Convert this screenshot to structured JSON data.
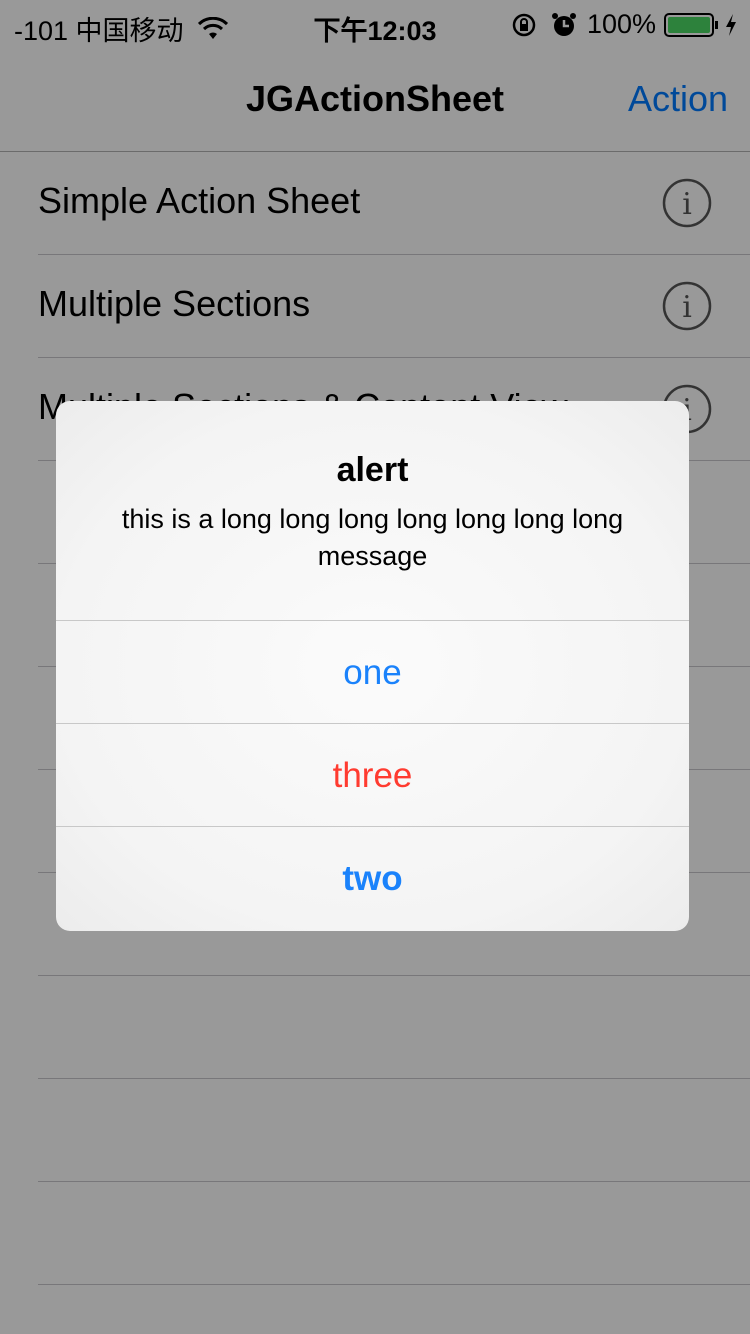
{
  "status_bar": {
    "carrier": "-101 中国移动",
    "time": "下午12:03",
    "battery": "100%",
    "icons": [
      "wifi-icon",
      "rotation-lock-icon",
      "alarm-icon",
      "battery-icon",
      "charging-icon"
    ]
  },
  "nav": {
    "title": "JGActionSheet",
    "action_label": "Action"
  },
  "table": {
    "rows": [
      {
        "label": "Simple Action Sheet",
        "icon": "info-icon"
      },
      {
        "label": "Multiple Sections",
        "icon": "info-icon"
      },
      {
        "label": "Multiple Sections & Content View",
        "icon": "info-icon"
      }
    ]
  },
  "alert": {
    "title": "alert",
    "message": "this is a long long long long long long long message",
    "buttons": [
      {
        "label": "one",
        "color": "#1a82fb"
      },
      {
        "label": "three",
        "color": "#ff3b30"
      },
      {
        "label": "two",
        "color": "#1a82fb"
      }
    ]
  },
  "colors": {
    "accent": "#007aff",
    "destructive": "#ff3b30"
  }
}
